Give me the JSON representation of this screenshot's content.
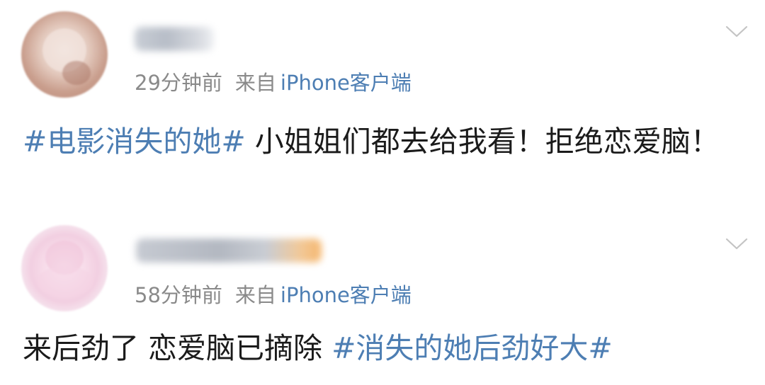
{
  "feed": {
    "comments": [
      {
        "username": "",
        "time": "29分钟前",
        "from": "来自",
        "device": "iPhone客户端",
        "topic": "#电影消失的她#",
        "text": " 小姐姐们都去给我看！拒绝恋爱脑！",
        "topic_after": "",
        "more_icon": "chevron-down-icon"
      },
      {
        "username": "",
        "time": "58分钟前",
        "from": "来自",
        "device": "iPhone客户端",
        "topic": "",
        "text": "来后劲了 恋爱脑已摘除 ",
        "topic_after": "#消失的她后劲好大#",
        "more_icon": "chevron-down-icon"
      }
    ]
  },
  "colors": {
    "topic_link": "#4d7eb3",
    "meta_gray": "#8a8a8a",
    "text": "#1b1b1b",
    "background": "#ffffff"
  }
}
